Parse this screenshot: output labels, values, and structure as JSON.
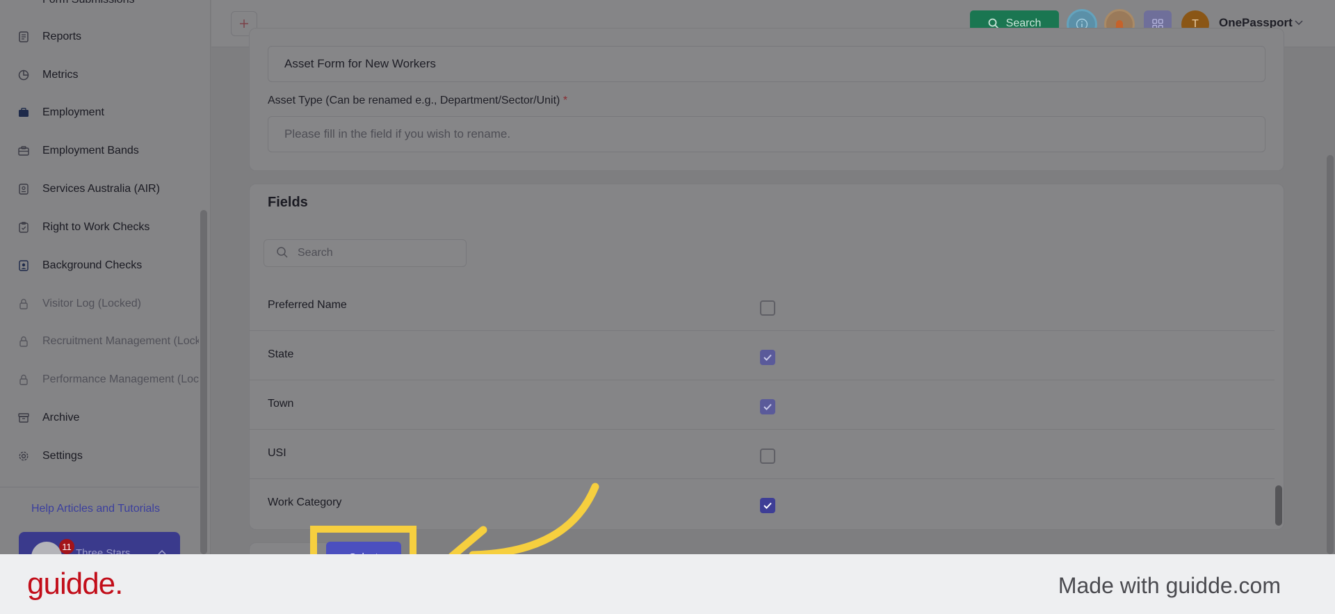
{
  "sidebar": {
    "partial_top_item": "Form Submissions",
    "items": [
      {
        "label": "Reports",
        "icon": "report-icon",
        "locked": false
      },
      {
        "label": "Metrics",
        "icon": "pie-chart-icon",
        "locked": false
      },
      {
        "label": "Employment",
        "icon": "briefcase-icon",
        "locked": false
      },
      {
        "label": "Employment Bands",
        "icon": "briefcase-outline-icon",
        "locked": false
      },
      {
        "label": "Services Australia (AIR)",
        "icon": "id-card-icon",
        "locked": false
      },
      {
        "label": "Right to Work Checks",
        "icon": "clipboard-check-icon",
        "locked": false
      },
      {
        "label": "Background Checks",
        "icon": "document-user-icon",
        "locked": false
      },
      {
        "label": "Visitor Log (Locked)",
        "icon": "lock-icon",
        "locked": true
      },
      {
        "label": "Recruitment Management (Locked)",
        "icon": "lock-icon",
        "locked": true
      },
      {
        "label": "Performance Management (Locked)",
        "icon": "lock-icon",
        "locked": true
      },
      {
        "label": "Archive",
        "icon": "archive-icon",
        "locked": false
      },
      {
        "label": "Settings",
        "icon": "gear-icon",
        "locked": false
      }
    ],
    "help_link": "Help Articles and Tutorials",
    "org": {
      "name": "Three Stars",
      "badge_count": "11"
    }
  },
  "topbar": {
    "search_label": "Search",
    "user_initial": "T",
    "user_name": "OnePassport"
  },
  "form": {
    "asset_form_value": "Asset Form for New Workers",
    "asset_type_label": "Asset Type (Can be renamed e.g., Department/Sector/Unit)",
    "required_marker": "*",
    "asset_type_placeholder": "Please fill in the field if you wish to rename."
  },
  "fields": {
    "title": "Fields",
    "search_placeholder": "Search",
    "rows": [
      {
        "name": "Preferred Name",
        "checked": false
      },
      {
        "name": "State",
        "checked": true
      },
      {
        "name": "Town",
        "checked": true
      },
      {
        "name": "USI",
        "checked": false
      },
      {
        "name": "Work Category",
        "checked": true
      }
    ]
  },
  "action": {
    "select_label": "Select"
  },
  "footer": {
    "logo": "guidde.",
    "text": "Made with guidde.com"
  },
  "colors": {
    "highlight": "#f6cf3f",
    "primary": "#4b4fbf",
    "search_green": "#1a7651",
    "brand_red": "#c20e1a"
  }
}
